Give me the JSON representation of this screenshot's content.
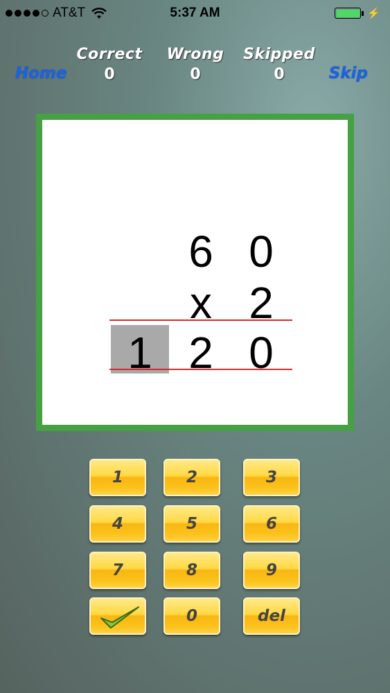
{
  "status_bar": {
    "carrier": "AT&T",
    "time": "5:37 AM"
  },
  "nav": {
    "home_label": "Home",
    "skip_label": "Skip"
  },
  "stats": [
    {
      "label": "Correct",
      "value": "0"
    },
    {
      "label": "Wrong",
      "value": "0"
    },
    {
      "label": "Skipped",
      "value": "0"
    }
  ],
  "problem": {
    "top": [
      "6",
      "0"
    ],
    "operator": "x",
    "multiplier": "2",
    "answer": [
      "1",
      "2",
      "0"
    ]
  },
  "keypad": {
    "keys": [
      "1",
      "2",
      "3",
      "4",
      "5",
      "6",
      "7",
      "8",
      "9"
    ],
    "zero": "0",
    "del": "del",
    "submit_icon": "checkmark-icon"
  },
  "colors": {
    "accent_blue": "#1c63e0",
    "card_border": "#46a044",
    "rule_red": "#d42a2a",
    "key_yellow": "#ffd843"
  }
}
